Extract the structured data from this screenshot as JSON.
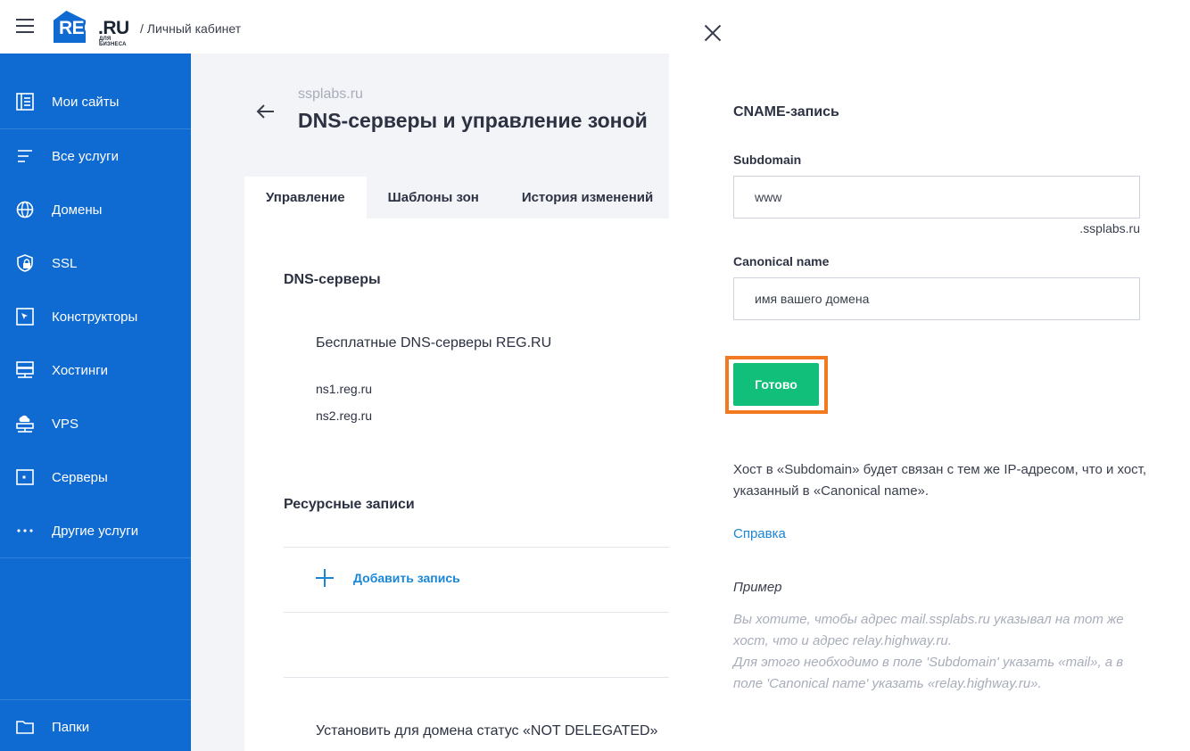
{
  "header": {
    "logo": {
      "main": "REG",
      "tld": ".RU",
      "sub": "ДЛЯ БИЗНЕСА"
    },
    "breadcrumb": "/ Личный кабинет"
  },
  "sidebar": {
    "items": [
      {
        "label": "Мои сайты",
        "icon": "sites-icon"
      },
      {
        "label": "Все услуги",
        "icon": "list-icon"
      },
      {
        "label": "Домены",
        "icon": "globe-icon"
      },
      {
        "label": "SSL",
        "icon": "shield-lock-icon"
      },
      {
        "label": "Конструкторы",
        "icon": "cursor-window-icon"
      },
      {
        "label": "Хостинги",
        "icon": "server-icon"
      },
      {
        "label": "VPS",
        "icon": "cloud-server-icon"
      },
      {
        "label": "Серверы",
        "icon": "monitor-icon"
      },
      {
        "label": "Другие услуги",
        "icon": "dots-icon"
      }
    ],
    "folders_label": "Папки",
    "color": "#0f6ad1"
  },
  "main": {
    "domain": "ssplabs.ru",
    "title": "DNS-серверы и управление зоной",
    "tabs": [
      {
        "label": "Управление",
        "active": true
      },
      {
        "label": "Шаблоны зон",
        "active": false
      },
      {
        "label": "История изменений",
        "active": false
      }
    ],
    "dns_heading": "DNS-серверы",
    "free_dns": "Бесплатные DNS-серверы REG.RU",
    "ns1": "ns1.reg.ru",
    "ns2": "ns2.reg.ru",
    "records_heading": "Ресурсные записи",
    "add_record": "Добавить запись",
    "not_delegated": "Установить для домена статус «NOT DELEGATED»"
  },
  "panel": {
    "title": "CNAME-запись",
    "subdomain_label": "Subdomain",
    "subdomain_value": "www",
    "subdomain_suffix": ".ssplabs.ru",
    "canonical_label": "Canonical name",
    "canonical_placeholder": "имя вашего домена",
    "done_button": "Готово",
    "description": "Хост в «Subdomain» будет связан с тем же IP-адресом, что и хост, указанный в «Canonical name».",
    "help_link": "Справка",
    "example_heading": "Пример",
    "example_line1": "Вы хотите, чтобы адрес mail.ssplabs.ru указывал на тот же хост, что и адрес relay.highway.ru.",
    "example_line2": "Для этого необходимо в поле 'Subdomain' указать «mail», а в поле 'Canonical name' указать «relay.highway.ru».",
    "accent_color": "#12bf7a",
    "highlight_color": "#f27b21",
    "link_color": "#1a86d6"
  }
}
